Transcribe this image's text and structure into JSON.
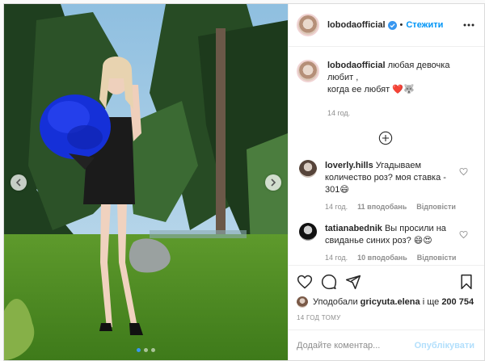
{
  "post": {
    "author": {
      "username": "lobodaofficial",
      "verified": true,
      "follow_label": "Стежити",
      "separator": "•"
    },
    "caption": {
      "username": "lobodaofficial",
      "line1": "любая девочка любит ,",
      "line2": "когда ее любят",
      "emoji": "❤️🐺",
      "time": "14 год."
    },
    "carousel": {
      "slides": 3,
      "active": 1
    },
    "comments": [
      {
        "username": "loverly.hills",
        "text": "Угадываем количество роз? моя ставка - 301😄",
        "time": "14 год.",
        "likes": "11 вподобань",
        "reply": "Відповісти"
      },
      {
        "username": "tatianabednik",
        "text": "Вы просили на свиданье синих роз? 😄😍",
        "time": "14 год.",
        "likes": "10 вподобань",
        "reply": "Відповісти"
      }
    ],
    "likes": {
      "prefix": "Уподобали",
      "user": "gricyuta.elena",
      "and": "і ще",
      "count": "200 754"
    },
    "timestamp": "14 ГОД ТОМУ",
    "add_comment": {
      "placeholder": "Додайте коментар...",
      "publish_label": "Опублікувати"
    },
    "icons": [
      "heart-icon",
      "comment-icon",
      "share-icon",
      "bookmark-icon",
      "more-icon",
      "plus-circle-icon",
      "verified-icon",
      "chevron-left-icon",
      "chevron-right-icon"
    ],
    "colors": {
      "link": "#0095f6",
      "muted": "#8e8e8e",
      "publish_disabled": "#b2dffc"
    }
  }
}
